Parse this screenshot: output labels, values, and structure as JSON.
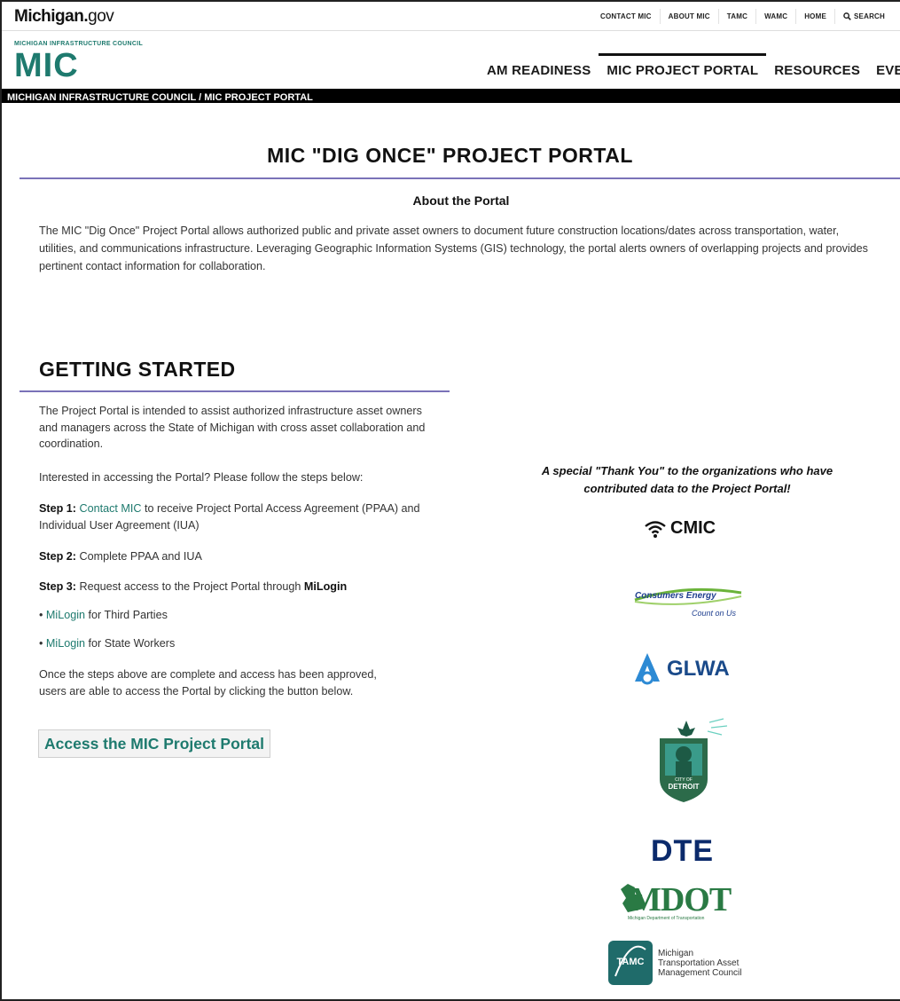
{
  "site": {
    "logo": "Michigan.",
    "logo_suffix": "gov"
  },
  "utility_nav": [
    {
      "label": "CONTACT MIC"
    },
    {
      "label": "ABOUT MIC"
    },
    {
      "label": "TAMC"
    },
    {
      "label": "WAMC"
    },
    {
      "label": "HOME"
    },
    {
      "label": "SEARCH",
      "icon": "search-icon"
    }
  ],
  "header": {
    "council_label": "MICHIGAN INFRASTRUCTURE COUNCIL",
    "logo_text": "MIC"
  },
  "main_nav": [
    {
      "label": "AM READINESS"
    },
    {
      "label": "MIC PROJECT PORTAL",
      "active": true
    },
    {
      "label": "RESOURCES"
    },
    {
      "label": "EVENTS"
    }
  ],
  "breadcrumb": "MICHIGAN INFRASTRUCTURE COUNCIL /  MIC PROJECT PORTAL",
  "page": {
    "title": "MIC \"DIG ONCE\" PROJECT PORTAL",
    "about_heading": "About the Portal",
    "about_text": "The MIC \"Dig Once\" Project Portal allows authorized public and private asset owners to document future construction locations/dates across transportation, water, utilities, and communications infrastructure. Leveraging Geographic Information Systems (GIS) technology, the portal alerts owners of overlapping projects and provides pertinent contact information for collaboration."
  },
  "getting_started": {
    "heading": "GETTING STARTED",
    "intro": "The Project Portal is intended to assist authorized infrastructure asset owners and managers across the State of Michigan with cross asset collaboration and coordination.",
    "question": "Interested in accessing the Portal? Please follow the steps below:",
    "step1_label": "Step 1:",
    "step1_link": "Contact MIC",
    "step1_text": " to receive Project Portal Access Agreement (PPAA) and Individual User Agreement (IUA)",
    "step2_label": "Step 2:",
    "step2_text": " Complete PPAA and IUA",
    "step3_label": "Step 3:",
    "step3_text": " Request access to the Project Portal through ",
    "step3_bold": "MiLogin",
    "link1": "MiLogin",
    "link1_text": " for Third Parties",
    "link2": "MiLogin",
    "link2_text": " for State Workers",
    "done_text": "Once the steps above are complete and access has been approved, users are able to access the Portal by clicking the button below.",
    "button_label": "Access the MIC Project Portal"
  },
  "thanks": {
    "line1": "A special \"Thank You\" to the organizations who have",
    "line2": "contributed data to the Project Portal!"
  },
  "partners": {
    "cmic": "CMIC",
    "consumers": "Consumers Energy",
    "consumers_tag": "Count on Us",
    "glwa": "GLWA",
    "detroit": "DETROIT",
    "detroit_small": "CITY OF",
    "dte": "DTE",
    "mdot": "MDOT",
    "mdot_sub": "Michigan Department of Transportation",
    "tamc_badge": "TAMC",
    "tamc_line1": "Michigan",
    "tamc_line2": "Transportation Asset",
    "tamc_line3": "Management Council"
  },
  "colors": {
    "accent": "#1e7a6e",
    "rule": "#7a72b8",
    "breadcrumb_bg": "#000000"
  }
}
